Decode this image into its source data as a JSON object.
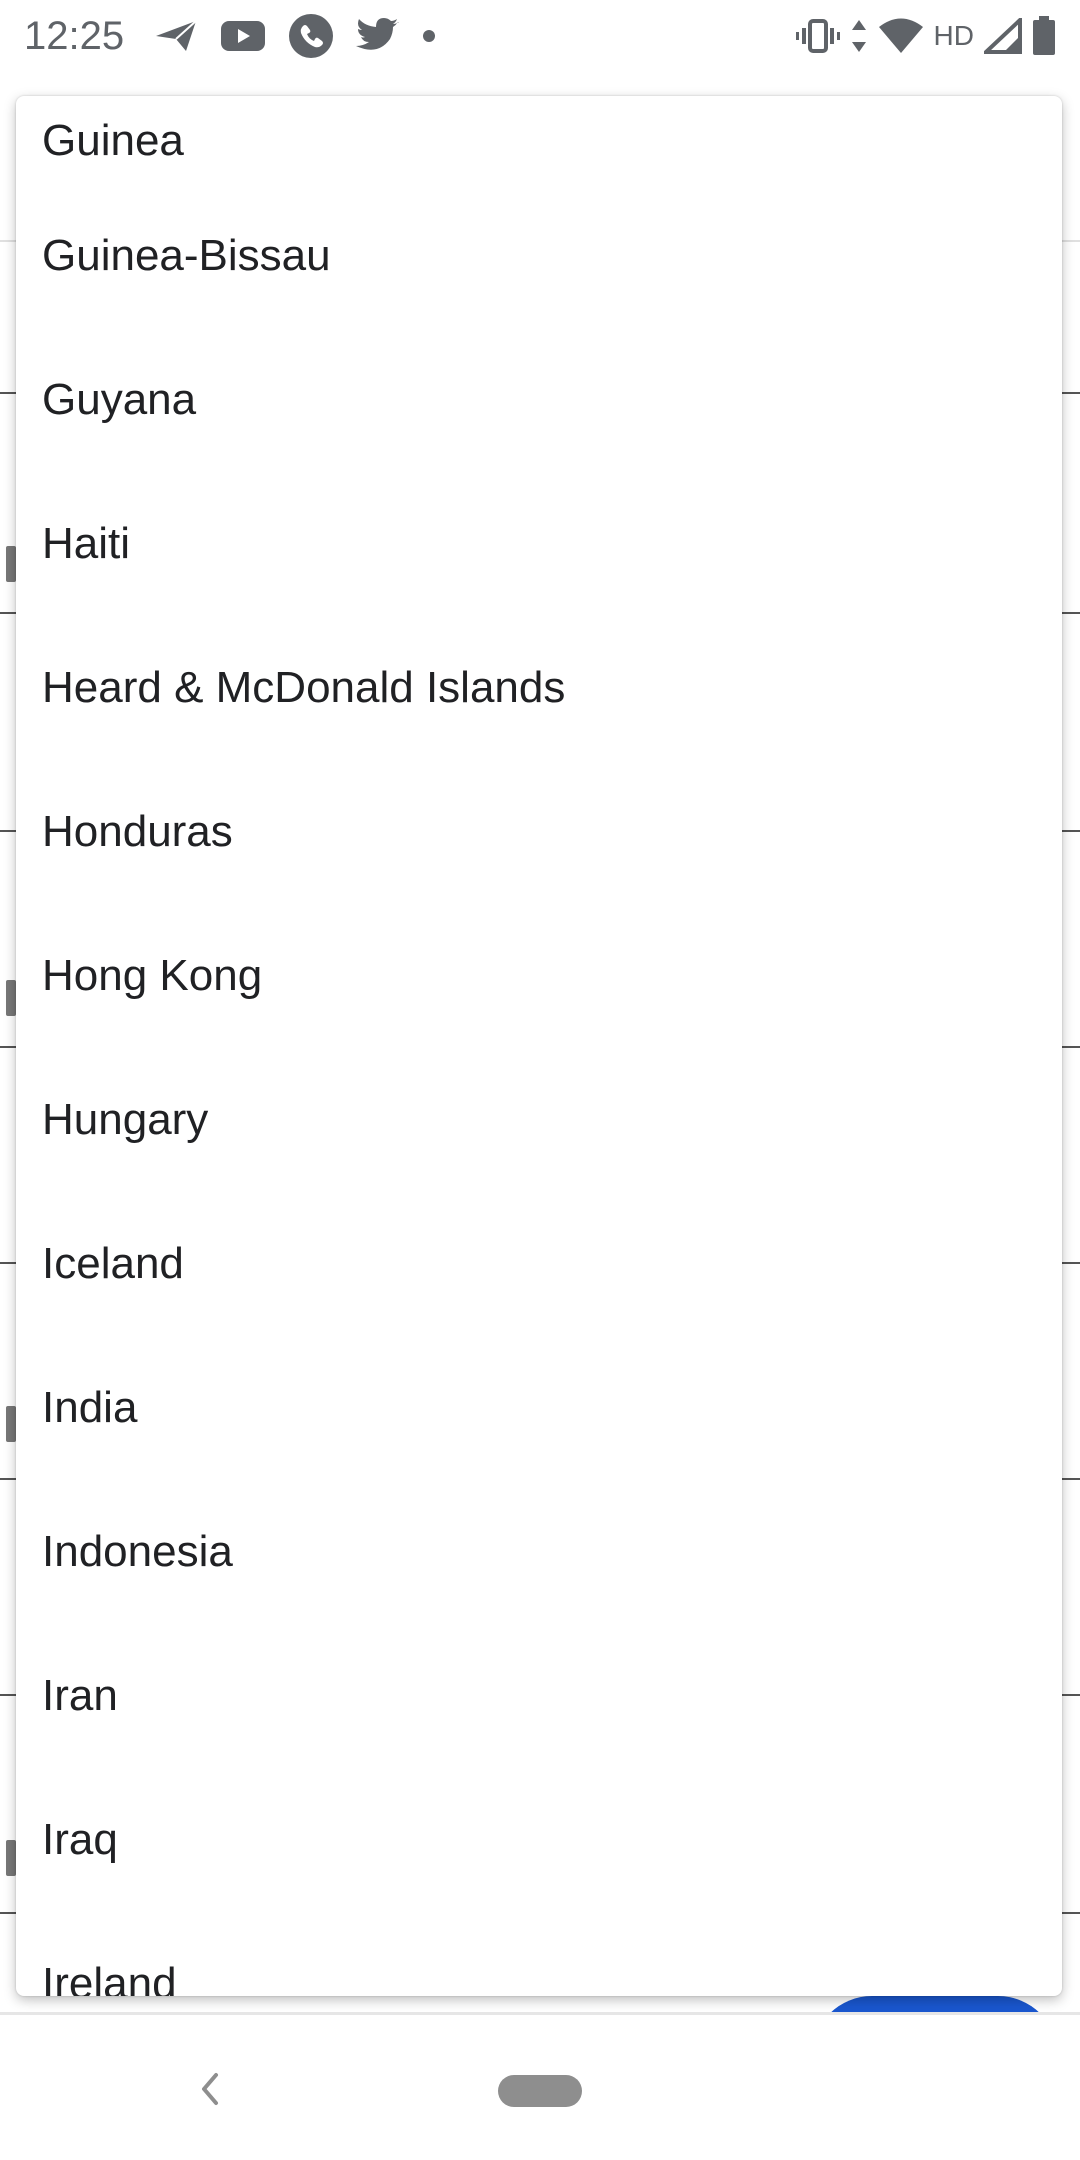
{
  "status_bar": {
    "time": "12:25",
    "left_icons": [
      "send-icon",
      "youtube-icon",
      "phone-icon",
      "twitter-icon",
      "dot-icon"
    ],
    "right_icons": [
      "vibrate-icon",
      "data-arrows-icon",
      "wifi-icon",
      "signal-icon",
      "battery-icon"
    ],
    "hd_label": "HD"
  },
  "dropdown": {
    "items": [
      {
        "label": "Guinea"
      },
      {
        "label": "Guinea-Bissau"
      },
      {
        "label": "Guyana"
      },
      {
        "label": "Haiti"
      },
      {
        "label": "Heard & McDonald Islands"
      },
      {
        "label": "Honduras"
      },
      {
        "label": "Hong Kong"
      },
      {
        "label": "Hungary"
      },
      {
        "label": "Iceland"
      },
      {
        "label": "India"
      },
      {
        "label": "Indonesia"
      },
      {
        "label": "Iran"
      },
      {
        "label": "Iraq"
      },
      {
        "label": "Ireland"
      }
    ]
  },
  "nav_bar": {
    "icons": [
      "back-icon",
      "home-pill-icon"
    ]
  },
  "colors": {
    "accent": "#1a57cf",
    "text": "#202124",
    "status_icons": "#5f6368"
  }
}
